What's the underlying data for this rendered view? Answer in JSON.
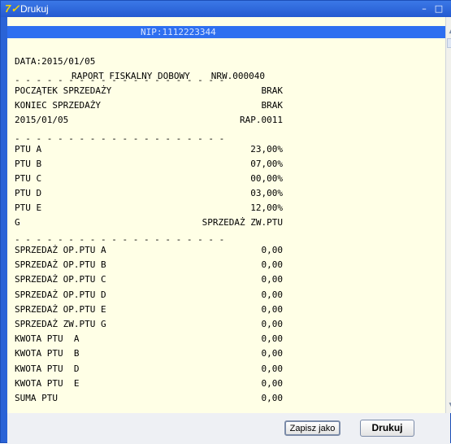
{
  "window": {
    "title": "Drukuj",
    "icon": "app-7-logo-icon",
    "minimize_glyph": "–",
    "maximize_glyph": "□"
  },
  "receipt": {
    "nip": "NIP:1112223344",
    "date": "DATA:2015/01/05",
    "nrw": "NRW.000040",
    "report_title": "RAPORT FISKALNY DOBOWY",
    "separator": "- - - - - - - - - - - - - - - - - - - -",
    "lines_block1": [
      {
        "label": "POCZĄTEK SPRZEDAŻY",
        "value": "BRAK"
      },
      {
        "label": "KONIEC SPRZEDAŻY",
        "value": "BRAK"
      },
      {
        "label": "2015/01/05",
        "value": "RAP.0011"
      }
    ],
    "ptu_rates": [
      {
        "label": "PTU A",
        "value": "23,00%"
      },
      {
        "label": "PTU B",
        "value": "07,00%"
      },
      {
        "label": "PTU C",
        "value": "00,00%"
      },
      {
        "label": "PTU D",
        "value": "03,00%"
      },
      {
        "label": "PTU E",
        "value": "12,00%"
      },
      {
        "label": "G",
        "value": "SPRZEDAŻ ZW.PTU"
      }
    ],
    "sales": [
      {
        "label": "SPRZEDAŻ OP.PTU A",
        "value": "0,00"
      },
      {
        "label": "SPRZEDAŻ OP.PTU B",
        "value": "0,00"
      },
      {
        "label": "SPRZEDAŻ OP.PTU C",
        "value": "0,00"
      },
      {
        "label": "SPRZEDAŻ OP.PTU D",
        "value": "0,00"
      },
      {
        "label": "SPRZEDAŻ OP.PTU E",
        "value": "0,00"
      },
      {
        "label": "SPRZEDAŻ ZW.PTU G",
        "value": "0,00"
      },
      {
        "label": "KWOTA PTU  A",
        "value": "0,00"
      },
      {
        "label": "KWOTA PTU  B",
        "value": "0,00"
      },
      {
        "label": "KWOTA PTU  D",
        "value": "0,00"
      },
      {
        "label": "KWOTA PTU  E",
        "value": "0,00"
      },
      {
        "label": "SUMA PTU",
        "value": "0,00"
      }
    ]
  },
  "buttons": {
    "save_as": "Zapisz jako",
    "print": "Drukuj"
  },
  "colors": {
    "title_bar": "#245ad0",
    "receipt_bg": "#ffffe6",
    "nip_bar": "#2e6ff0"
  }
}
